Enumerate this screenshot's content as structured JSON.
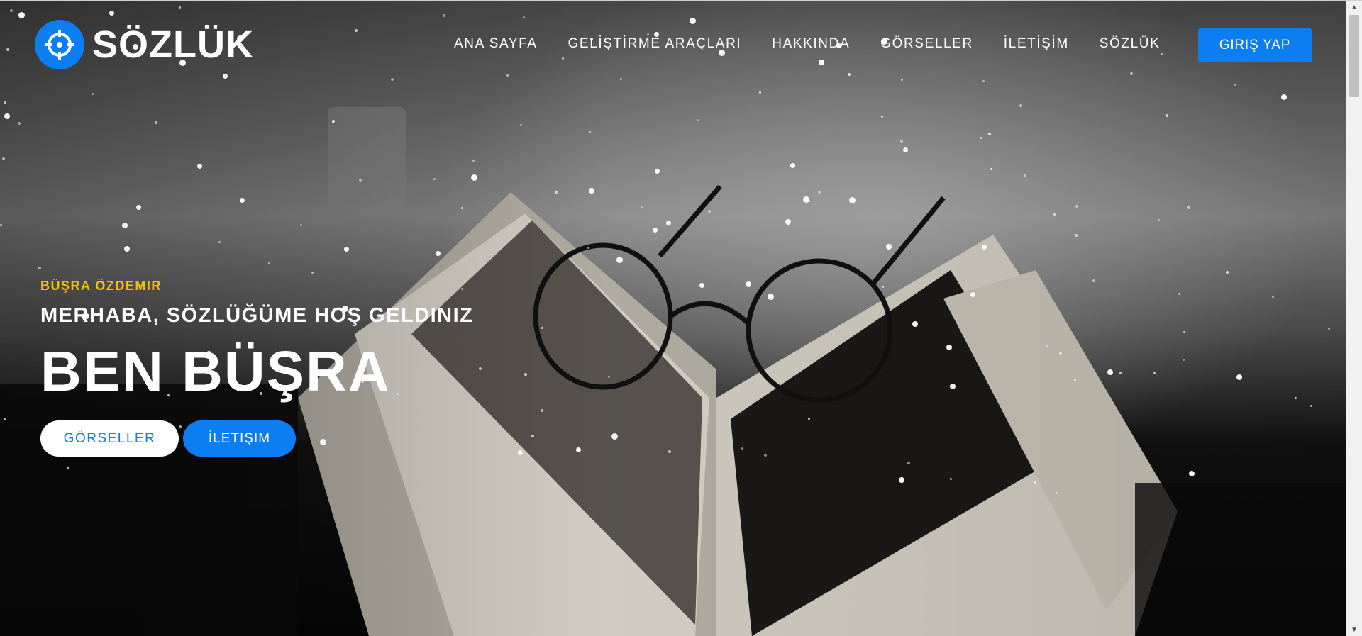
{
  "brand": {
    "name": "SÖZLÜK",
    "icon": "crosshair-icon",
    "accent": "#0d7df2"
  },
  "nav": {
    "items": [
      {
        "label": "ANA SAYFA"
      },
      {
        "label": "GELİŞTİRME ARAÇLARI"
      },
      {
        "label": "HAKKINDA"
      },
      {
        "label": "GÖRSELLER"
      },
      {
        "label": "İLETİŞİM"
      },
      {
        "label": "SÖZLÜK"
      }
    ],
    "login_label": "GIRIŞ YAP"
  },
  "hero": {
    "author": "BÜŞRA ÖZDEMIR",
    "welcome": "MERHABA, SÖZLÜĞÜME HOŞ GELDINIZ",
    "name": "BEN BÜŞRA",
    "primary_button": "GÖRSELLER",
    "secondary_button": "İLETIŞIM",
    "author_color": "#f2c200"
  }
}
